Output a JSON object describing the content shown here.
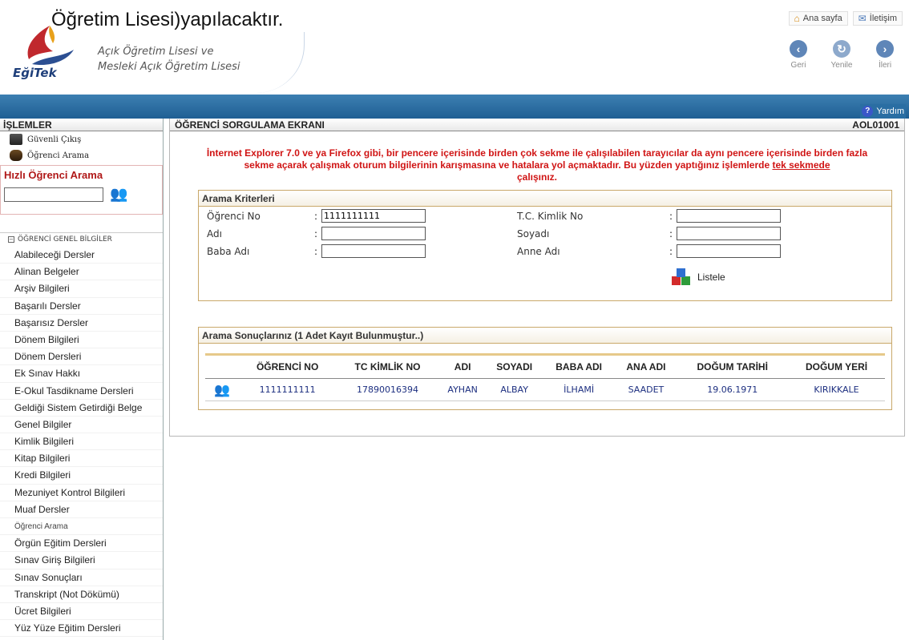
{
  "document": {
    "partial_line": "Öğretim Lisesi)yapılacaktır."
  },
  "header": {
    "logo_text": "EğiTek",
    "school_line1": "Açık Öğretim Lisesi ve",
    "school_line2": "Mesleki Açık Öğretim Lisesi",
    "top_links": [
      {
        "label": "Ana sayfa",
        "icon": "home-icon"
      },
      {
        "label": "İletişim",
        "icon": "mail-icon"
      }
    ],
    "nav": [
      {
        "label": "Geri",
        "icon": "back-icon",
        "glyph": "‹"
      },
      {
        "label": "Yenile",
        "icon": "refresh-icon",
        "glyph": "↻"
      },
      {
        "label": "İleri",
        "icon": "forward-icon",
        "glyph": "›"
      }
    ],
    "help_label": "Yardım"
  },
  "sidebar": {
    "title": "İŞLEMLER",
    "actions": [
      {
        "label": "Güvenli Çıkış",
        "icon": "logout-icon"
      },
      {
        "label": "Öğrenci Arama",
        "icon": "binoculars-icon"
      }
    ],
    "quick_search": {
      "title": "Hızlı Öğrenci Arama",
      "value": ""
    },
    "section_title": "ÖĞRENCİ GENEL BİLGİLER",
    "items": [
      "Alabileceği Dersler",
      "Alinan Belgeler",
      "Arşiv Bilgileri",
      "Başarılı Dersler",
      "Başarısız Dersler",
      "Dönem Bilgileri",
      "Dönem Dersleri",
      "Ek Sınav Hakkı",
      "E-Okul Tasdikname Dersleri",
      "Geldiği Sistem Getirdiği Belge",
      "Genel Bilgiler",
      "Kimlik Bilgileri",
      "Kitap Bilgileri",
      "Kredi Bilgileri",
      "Mezuniyet Kontrol Bilgileri",
      "Muaf Dersler",
      "Öğrenci Arama",
      "Örgün Eğitim Dersleri",
      "Sınav Giriş Bilgileri",
      "Sınav Sonuçları",
      "Transkript (Not Dökümü)",
      "Ücret Bilgileri",
      "Yüz Yüze Eğitim Dersleri"
    ]
  },
  "main": {
    "title": "ÖĞRENCİ SORGULAMA EKRANI",
    "code": "AOL01001",
    "warning_text": "İnternet Explorer 7.0 ve ya Firefox gibi, bir pencere içerisinde birden çok sekme ile çalışılabilen tarayıcılar da aynı pencere içerisinde birden fazla sekme açarak çalışmak oturum bilgilerinin karışmasına ve hatalara yol açmaktadır. Bu yüzden yaptığınız işlemlerde ",
    "warning_link": "tek sekmede",
    "warning_end": "çalışınız.",
    "criteria": {
      "title": "Arama Kriterleri",
      "fields": [
        {
          "label": "Öğrenci No",
          "value": "1111111111"
        },
        {
          "label": "Adı",
          "value": ""
        },
        {
          "label": "Baba Adı",
          "value": ""
        },
        {
          "label": "T.C. Kimlik No",
          "value": ""
        },
        {
          "label": "Soyadı",
          "value": ""
        },
        {
          "label": "Anne Adı",
          "value": ""
        }
      ],
      "colon": ":",
      "list_button": "Listele"
    },
    "results": {
      "title": "Arama Sonuçlarınız (1 Adet Kayıt Bulunmuştur..)",
      "columns": [
        "ÖĞRENCİ NO",
        "TC KİMLİK NO",
        "ADI",
        "SOYADI",
        "BABA ADI",
        "ANA ADI",
        "DOĞUM TARİHİ",
        "DOĞUM YERİ"
      ],
      "rows": [
        [
          "1111111111",
          "17890016394",
          "AYHAN",
          "ALBAY",
          "İLHAMİ",
          "SAADET",
          "19.06.1971",
          "KIRIKKALE"
        ]
      ]
    }
  },
  "colors": {
    "accent_blue": "#2a6ea3",
    "warning_red": "#d01414",
    "panel_border": "#c9a86a"
  }
}
